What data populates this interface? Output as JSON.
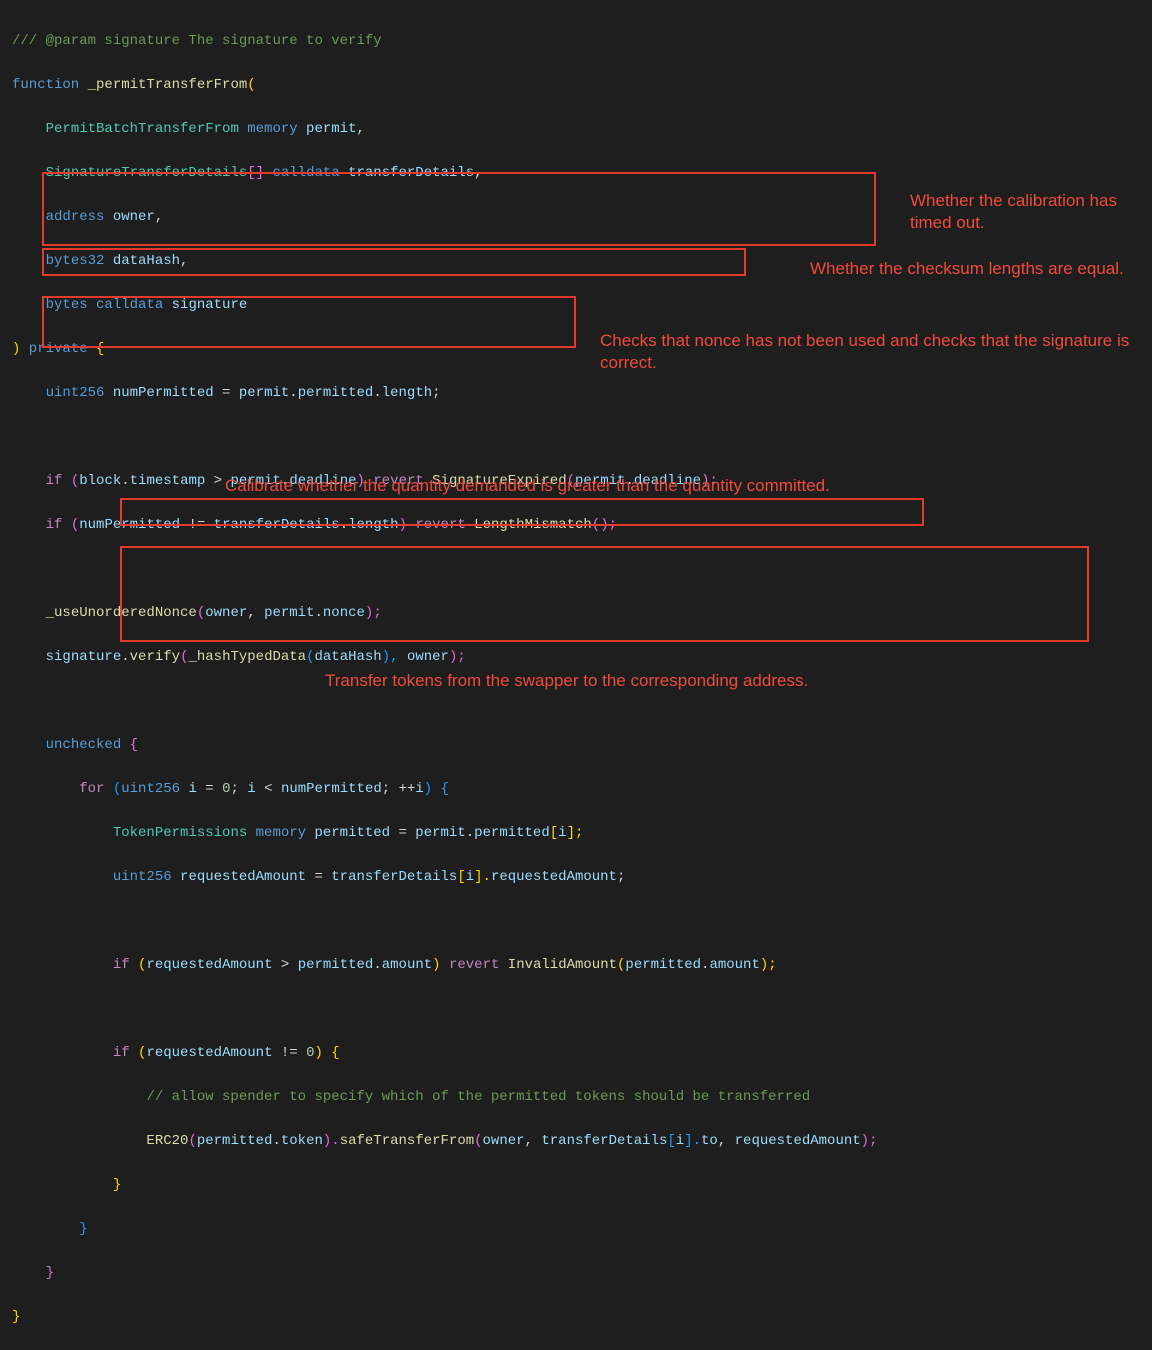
{
  "code": {
    "l00a": "/// @param signature The signature to verify",
    "l00_fn": "function",
    "l00_name": " _permitTransferFrom",
    "l00_open": "(",
    "l01_type": "PermitBatchTransferFrom",
    "l01_mem": " memory",
    "l01_var": " permit",
    "l01_end": ",",
    "l02_type": "SignatureTransferDetails",
    "l02_arr": "[]",
    "l02_cd": " calldata",
    "l02_var": " transferDetails",
    "l02_end": ",",
    "l03_type": "address",
    "l03_var": " owner",
    "l03_end": ",",
    "l04_type": "bytes32",
    "l04_var": " dataHash",
    "l04_end": ",",
    "l05_type": "bytes",
    "l05_cd": " calldata",
    "l05_var": " signature",
    "l06_close": ")",
    "l06_priv": " private ",
    "l06_brace": "{",
    "l07_type": "uint256",
    "l07_var": " numPermitted",
    "l07_eq": " = ",
    "l07_p": "permit",
    "l07_dot": ".",
    "l07_perm": "permitted",
    "l07_len": "length",
    "l07_semi": ";",
    "l09_if": "if",
    "l09_open": " (",
    "l09_block": "block",
    "l09_ts": "timestamp",
    "l09_gt": " > ",
    "l09_permit": "permit",
    "l09_dl": "deadline",
    "l09_close": ") ",
    "l09_rev": "revert",
    "l09_err": " SignatureExpired",
    "l09_open2": "(",
    "l09_close2": ");",
    "l10_if": "if",
    "l10_open": " (",
    "l10_np": "numPermitted",
    "l10_neq": " != ",
    "l10_td": "transferDetails",
    "l10_len": "length",
    "l10_close": ") ",
    "l10_rev": "revert",
    "l10_err": " LengthMismatch",
    "l10_p": "();",
    "l12_fn": "_useUnorderedNonce",
    "l12_open": "(",
    "l12_owner": "owner",
    "l12_c": ", ",
    "l12_permit": "permit",
    "l12_nonce": "nonce",
    "l12_close": ");",
    "l13_sig": "signature",
    "l13_v": "verify",
    "l13_open": "(",
    "l13_htd": "_hashTypedData",
    "l13_open2": "(",
    "l13_dh": "dataHash",
    "l13_close2": "), ",
    "l13_owner": "owner",
    "l13_close": ");",
    "l15_unchk": "unchecked",
    "l15_brace": " {",
    "l16_for": "for",
    "l16_open": " (",
    "l16_u": "uint256",
    "l16_i": " i",
    "l16_eq": " = ",
    "l16_0": "0",
    "l16_semi": "; ",
    "l16_i2": "i",
    "l16_lt": " < ",
    "l16_np": "numPermitted",
    "l16_semi2": "; ",
    "l16_pp": "++",
    "l16_i3": "i",
    "l16_close": ") {",
    "l17_tp": "TokenPermissions",
    "l17_mem": " memory",
    "l17_perm": " permitted",
    "l17_eq": " = ",
    "l17_p": "permit",
    "l17_dot": ".",
    "l17_pp": "permitted",
    "l17_br": "[",
    "l17_i": "i",
    "l17_brc": "];",
    "l18_u": "uint256",
    "l18_ra": " requestedAmount",
    "l18_eq": " = ",
    "l18_td": "transferDetails",
    "l18_br": "[",
    "l18_i": "i",
    "l18_brc": "].",
    "l18_ram": "requestedAmount",
    "l18_semi": ";",
    "l20_if": "if",
    "l20_open": " (",
    "l20_ra": "requestedAmount",
    "l20_gt": " > ",
    "l20_perm": "permitted",
    "l20_amt": "amount",
    "l20_close": ") ",
    "l20_rev": "revert",
    "l20_err": " InvalidAmount",
    "l20_open2": "(",
    "l20_close2": ");",
    "l22_if": "if",
    "l22_open": " (",
    "l22_ra": "requestedAmount",
    "l22_neq": " != ",
    "l22_0": "0",
    "l22_close": ") {",
    "l23_cmt": "// allow spender to specify which of the permitted tokens should be transferred",
    "l24_erc": "ERC20",
    "l24_open": "(",
    "l24_perm": "permitted",
    "l24_tok": "token",
    "l24_close": ").",
    "l24_stf": "safeTransferFrom",
    "l24_open2": "(",
    "l24_owner": "owner",
    "l24_c": ", ",
    "l24_td": "transferDetails",
    "l24_br": "[",
    "l24_i": "i",
    "l24_brc": "].",
    "l24_to": "to",
    "l24_c2": ", ",
    "l24_ra": "requestedAmount",
    "l24_close2": ");",
    "l25_b": "}",
    "l26_b": "}",
    "l27_b": "}",
    "l28_b": "}"
  },
  "annotations": {
    "a1": "Whether the calibration has timed out.",
    "a2": "Whether the checksum lengths are equal.",
    "a3": "Checks that nonce has not been used and checks that the signature is correct.",
    "a4": "Calibrate whether the quantity demanded is greater than the quantity committed.",
    "a5": "Transfer tokens from the swapper to the corresponding address."
  }
}
